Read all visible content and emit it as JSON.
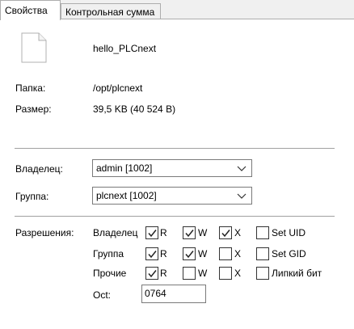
{
  "tabs": [
    {
      "label": "Свойства",
      "active": true
    },
    {
      "label": "Контрольная сумма",
      "active": false
    }
  ],
  "file": {
    "icon": "file-icon",
    "name": "hello_PLCnext"
  },
  "info": {
    "folder_label": "Папка:",
    "folder_value": "/opt/plcnext",
    "size_label": "Размер:",
    "size_value": "39,5 KB (40 524 B)"
  },
  "owner": {
    "label": "Владелец:",
    "value": "admin [1002]"
  },
  "group": {
    "label": "Группа:",
    "value": "plcnext [1002]"
  },
  "permissions": {
    "label": "Разрешения:",
    "rows": [
      {
        "name": "Владелец",
        "r": true,
        "w": true,
        "x": true,
        "special_label": "Set UID",
        "special": false
      },
      {
        "name": "Группа",
        "r": true,
        "w": true,
        "x": false,
        "special_label": "Set GID",
        "special": false
      },
      {
        "name": "Прочие",
        "r": true,
        "w": false,
        "x": false,
        "special_label": "Липкий бит",
        "special": false
      }
    ],
    "r_label": "R",
    "w_label": "W",
    "x_label": "X",
    "octal_label": "Oct:",
    "octal_value": "0764"
  }
}
